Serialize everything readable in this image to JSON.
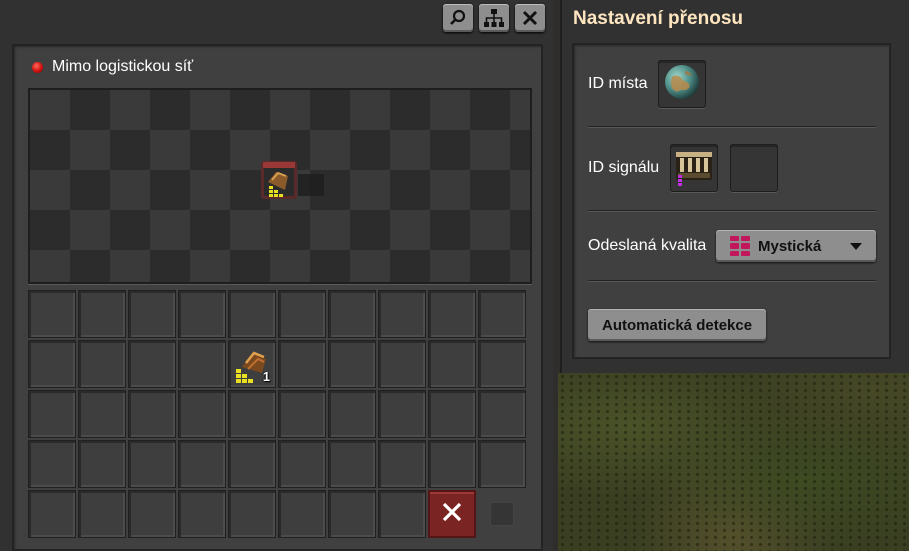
{
  "left_window": {
    "title_buttons": [
      {
        "name": "search-button",
        "icon": "search-icon"
      },
      {
        "name": "network-button",
        "icon": "network-tree-icon"
      },
      {
        "name": "close-button",
        "icon": "close-icon"
      }
    ],
    "status": {
      "text": "Mimo logistickou síť",
      "color": "#d01010"
    },
    "preview": {
      "entity_icon": "cargo-landing-pad-icon"
    },
    "inventory": {
      "columns": 10,
      "rows": 5,
      "items": [
        {
          "slot": 14,
          "icon": "rocket-part-item-icon",
          "count": "1"
        }
      ],
      "clear_icon": "close-icon"
    }
  },
  "right_window": {
    "title": "Nastavení přenosu",
    "location_label": "ID místa",
    "location_icon": "planet-nauvis-icon",
    "signal_label": "ID signálu",
    "signal_icon": "cargo-bay-signal-icon",
    "quality_label": "Odeslaná kvalita",
    "quality_value": "Mystická",
    "quality_color": "#c2185b",
    "auto_detect_label": "Automatická detekce"
  }
}
